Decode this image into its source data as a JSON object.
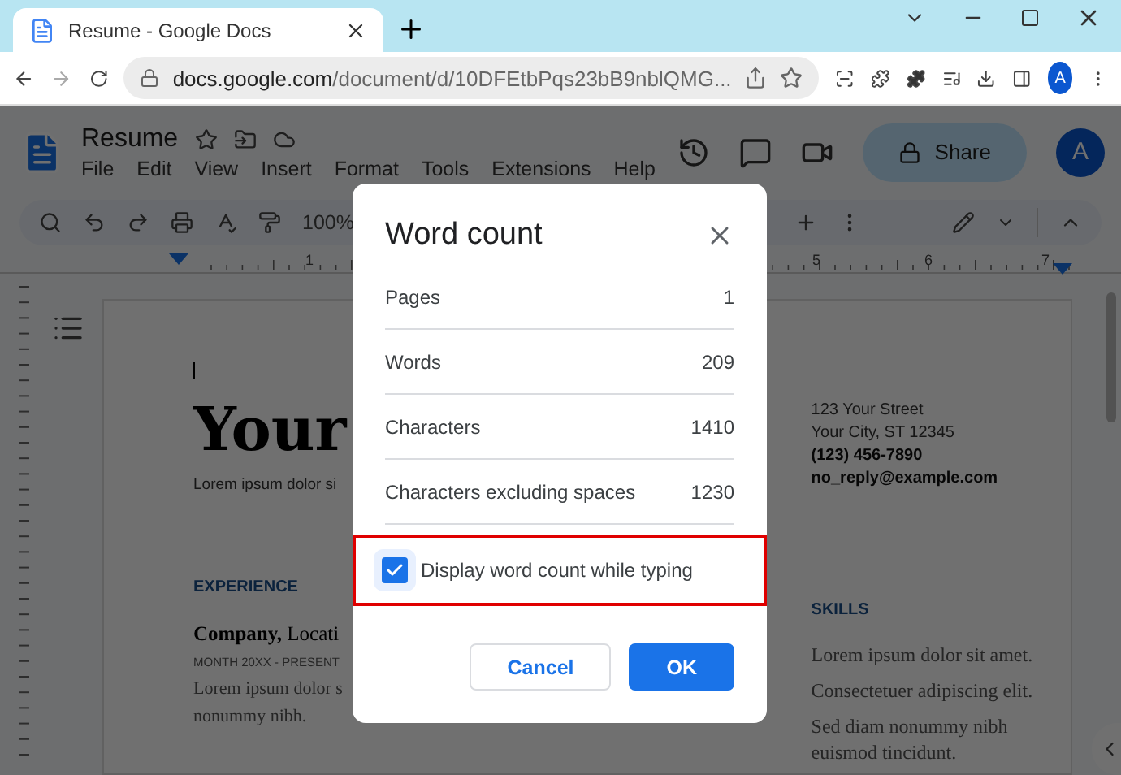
{
  "browser": {
    "tab_title": "Resume - Google Docs",
    "url_host": "docs.google.com",
    "url_path": "/document/d/10DFEtbPqs23bB9nblQMG...",
    "profile_initial": "A"
  },
  "docs": {
    "title": "Resume",
    "menu": [
      "File",
      "Edit",
      "View",
      "Insert",
      "Format",
      "Tools",
      "Extensions",
      "Help"
    ],
    "zoom": "100%",
    "share": "Share",
    "avatar": "A"
  },
  "ruler": [
    "1",
    "5",
    "6",
    "7"
  ],
  "document": {
    "heading": "Your",
    "intro": "Lorem ipsum dolor si",
    "section_left": "EXPERIENCE",
    "company": "**Company,** Locati",
    "dates": "MONTH 20XX - PRESENT",
    "body": [
      "Lorem ipsum dolor s",
      "nonummy nibh."
    ],
    "contact": [
      {
        "text": "123 Your Street",
        "bold": false
      },
      {
        "text": "Your City, ST 12345",
        "bold": false
      },
      {
        "text": "(123) 456-7890",
        "bold": true
      },
      {
        "text": "no_reply@example.com",
        "bold": true
      }
    ],
    "section_right": "SKILLS",
    "skills": [
      "Lorem ipsum dolor sit amet.",
      "Consectetuer adipiscing elit.",
      "Sed diam nonummy nibh euismod tincidunt."
    ]
  },
  "dialog": {
    "title": "Word count",
    "stats": [
      {
        "label": "Pages",
        "value": "1"
      },
      {
        "label": "Words",
        "value": "209"
      },
      {
        "label": "Characters",
        "value": "1410"
      },
      {
        "label": "Characters excluding spaces",
        "value": "1230"
      }
    ],
    "option": {
      "label": "Display word count while typing",
      "checked": true,
      "highlighted": true
    },
    "buttons": [
      {
        "label": "Cancel",
        "kind": "secondary"
      },
      {
        "label": "OK",
        "kind": "primary"
      }
    ]
  }
}
